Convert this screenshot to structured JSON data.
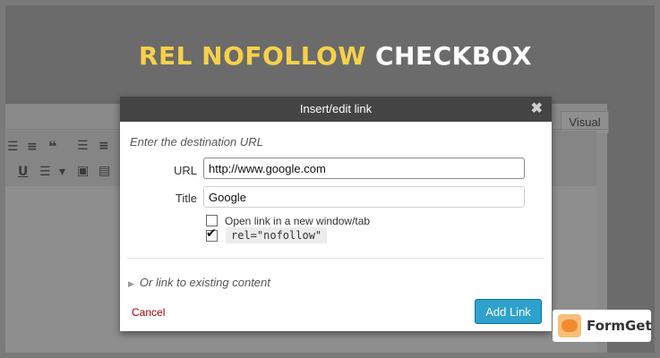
{
  "banner": {
    "title_highlight": "REL NOFOLLOW",
    "title_rest": "CHECKBOX"
  },
  "editor": {
    "visual_tab": "Visual",
    "toolbar_icons": [
      "bullet-list-icon",
      "numbered-list-icon",
      "blockquote-icon",
      "align-center-icon",
      "align-right-icon",
      "underline-icon",
      "justify-icon",
      "paste-text-icon",
      "paste-word-icon"
    ]
  },
  "dialog": {
    "title": "Insert/edit link",
    "close_glyph": "✖",
    "instruction": "Enter the destination URL",
    "url_label": "URL",
    "url_value": "http://www.google.com",
    "title_label": "Title",
    "title_value": "Google",
    "new_window_label": "Open link in a new window/tab",
    "new_window_checked": false,
    "nofollow_label": "rel=\"nofollow\"",
    "nofollow_checked": true,
    "existing_content_label": "Or link to existing content",
    "cancel_label": "Cancel",
    "add_link_label": "Add Link",
    "colors": {
      "header": "#444444",
      "primary": "#2ea2cc",
      "cancel": "#a00000"
    }
  },
  "logo": {
    "text": "FormGet"
  }
}
